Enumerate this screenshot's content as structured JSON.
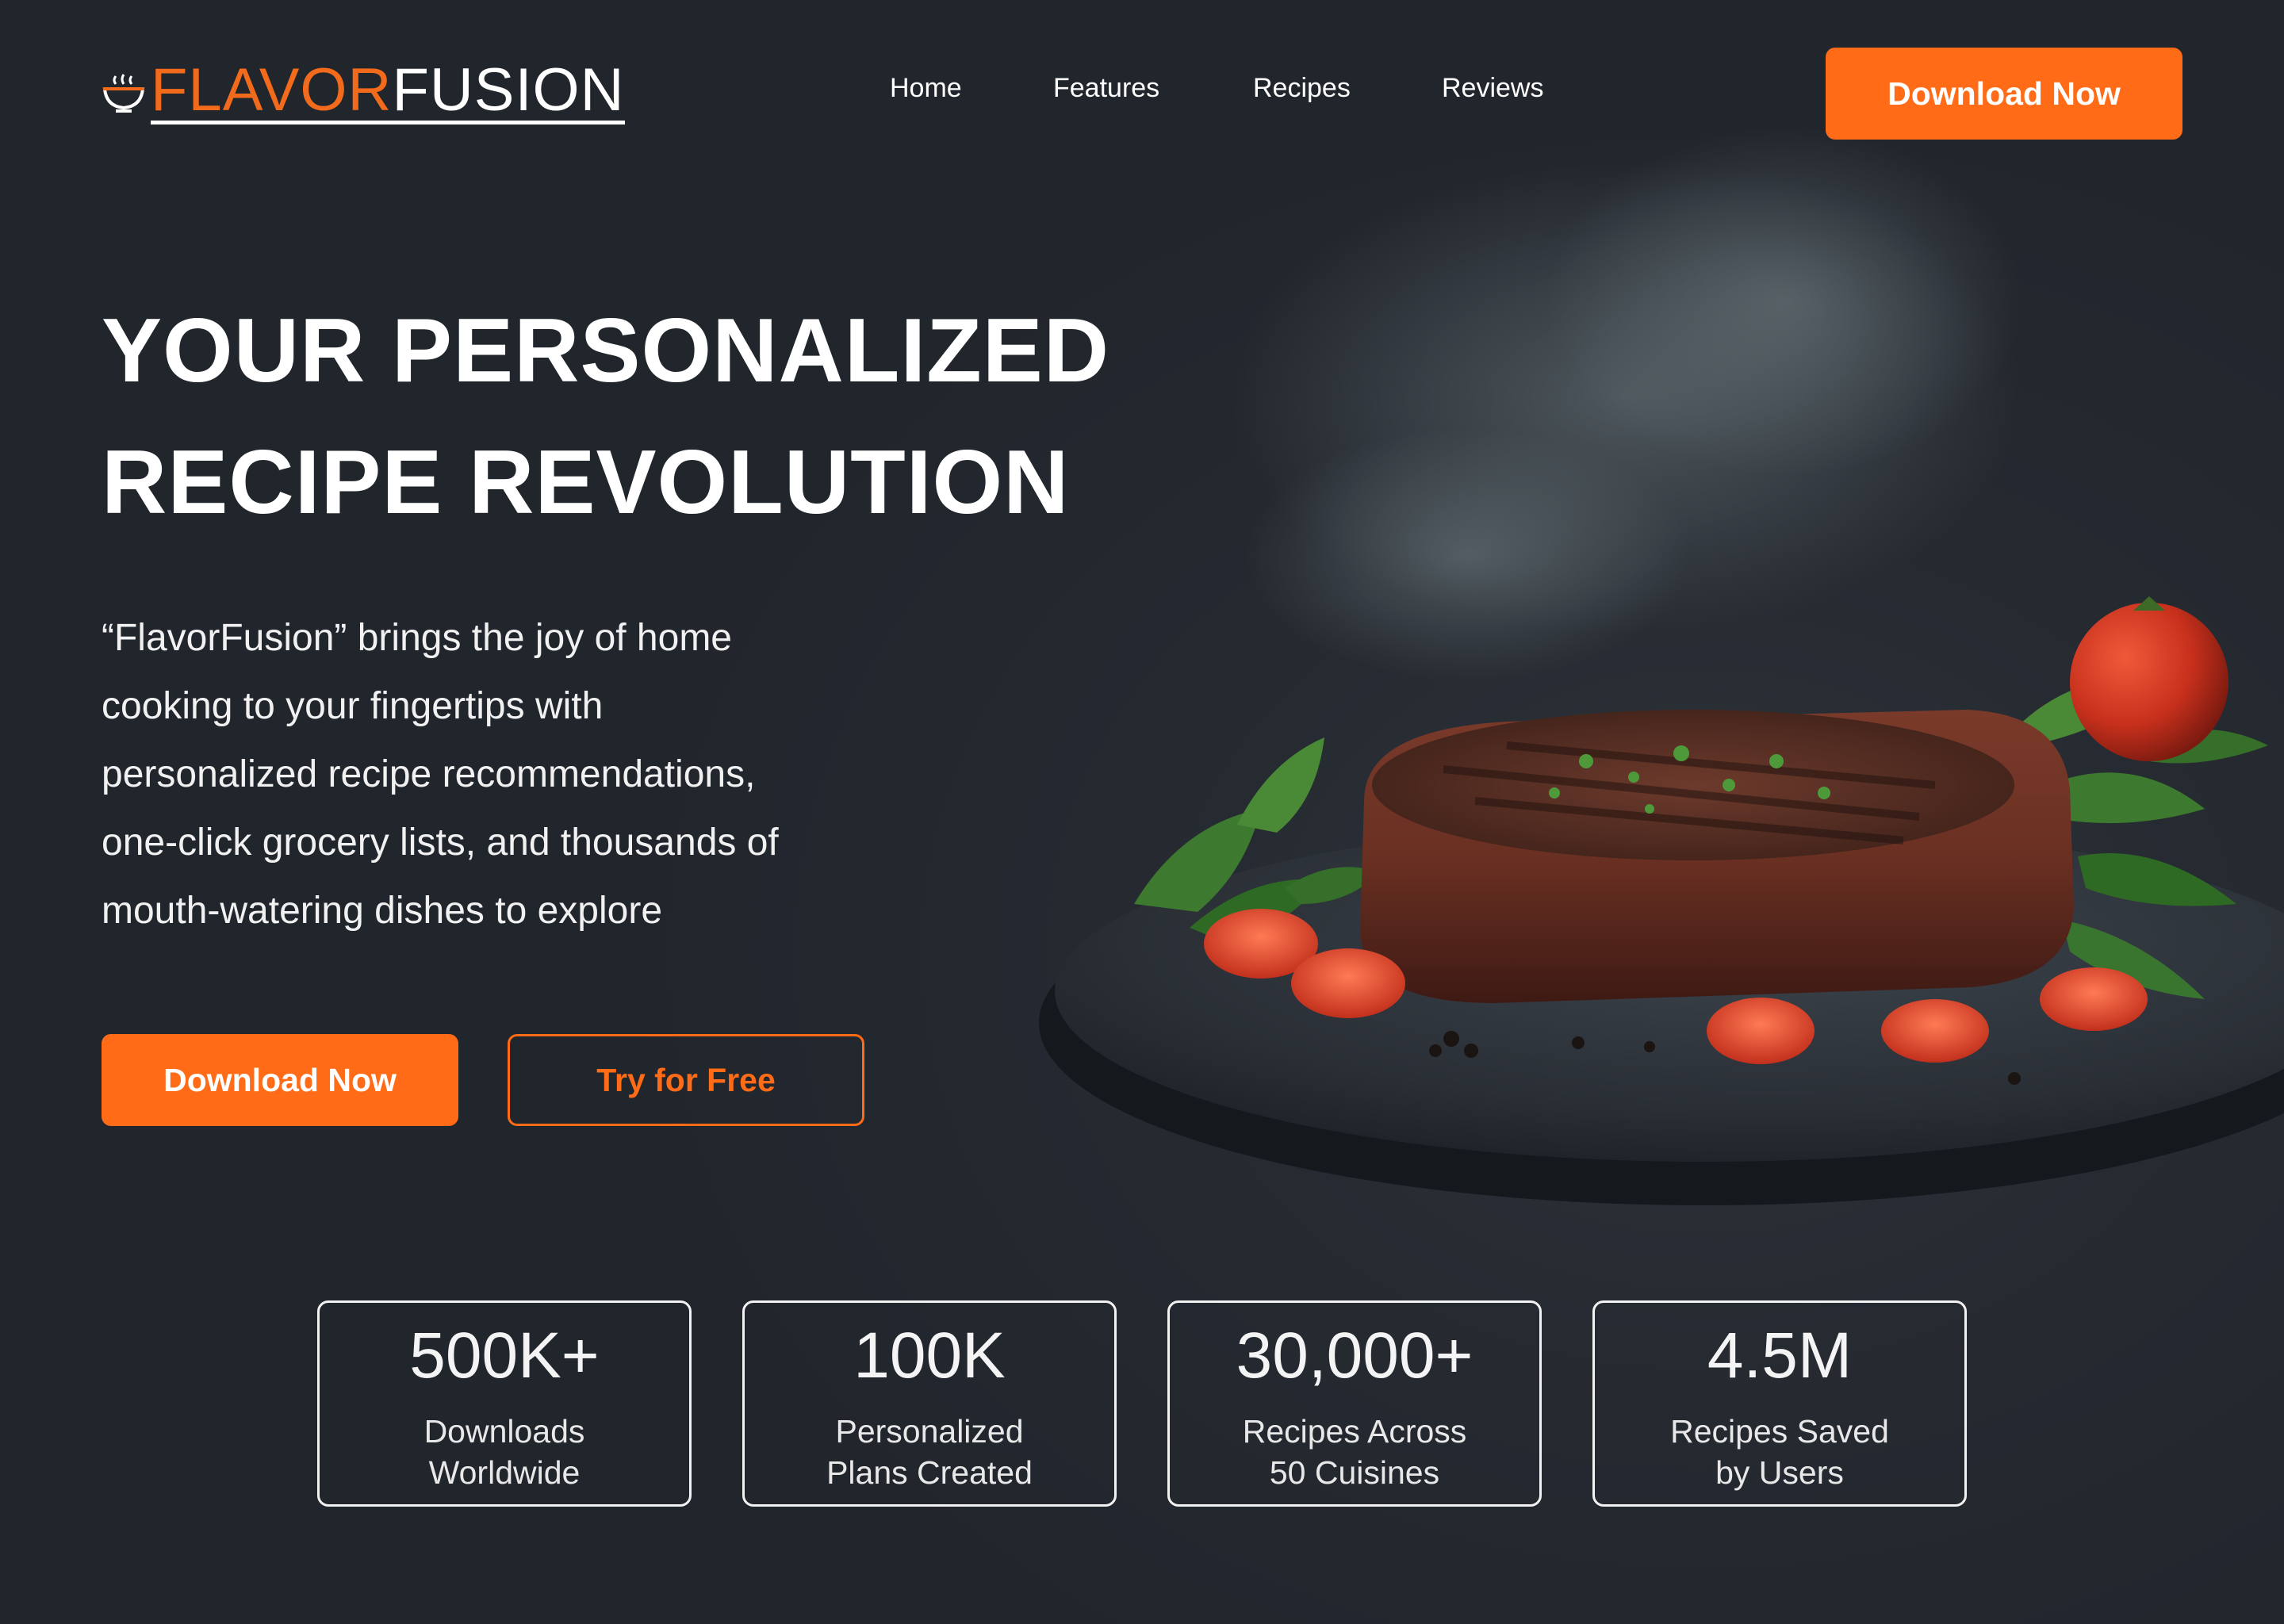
{
  "colors": {
    "accent": "#ff6b16",
    "background": "#23272f",
    "text": "#ffffff"
  },
  "brand": {
    "name_part1": "FLAVOR",
    "name_part2": "FUSION",
    "icon": "cooking-bowl-icon"
  },
  "nav": {
    "items": [
      "Home",
      "Features",
      "Recipes",
      "Reviews"
    ]
  },
  "header": {
    "cta_label": "Download Now"
  },
  "hero": {
    "headline_line1": "YOUR PERSONALIZED",
    "headline_line2": "RECIPE REVOLUTION",
    "description_lines": [
      "“FlavorFusion” brings the joy of home",
      "cooking to your fingertips with",
      "personalized recipe recommendations,",
      "one-click grocery lists, and thousands of",
      "mouth-watering dishes to explore"
    ],
    "primary_cta": "Download Now",
    "secondary_cta": "Try for Free",
    "image": "steak-on-slate-plate-with-tomatoes-and-arugula"
  },
  "stats": [
    {
      "value": "500K+",
      "label_line1": "Downloads",
      "label_line2": "Worldwide"
    },
    {
      "value": "100K",
      "label_line1": "Personalized",
      "label_line2": "Plans Created"
    },
    {
      "value": "30,000+",
      "label_line1": "Recipes Across",
      "label_line2": "50 Cuisines"
    },
    {
      "value": "4.5M",
      "label_line1": "Recipes Saved",
      "label_line2": "by Users"
    }
  ]
}
